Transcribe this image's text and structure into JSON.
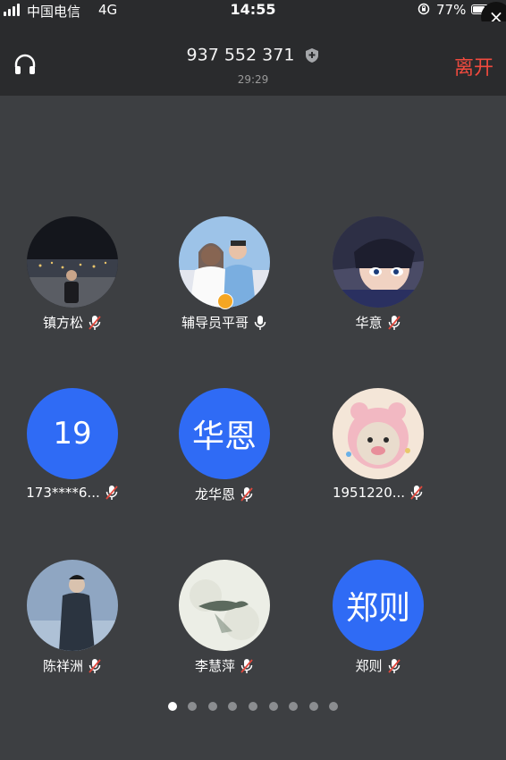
{
  "status_bar": {
    "carrier": "中国电信",
    "network": "4G",
    "time": "14:55",
    "battery_percent": "77%",
    "battery_level": 0.77,
    "close_label": "×"
  },
  "header": {
    "meeting_id": "937 552 371",
    "duration": "29:29",
    "leave_label": "离开"
  },
  "participants": [
    {
      "name": "镇方松",
      "mic": "muted",
      "avatar_type": "photo",
      "avatar_text": ""
    },
    {
      "name": "辅导员平哥",
      "mic": "on",
      "avatar_type": "photo",
      "avatar_text": "",
      "host": true
    },
    {
      "name": "华意",
      "mic": "muted",
      "avatar_type": "photo",
      "avatar_text": ""
    },
    {
      "name": "173****6...",
      "mic": "muted",
      "avatar_type": "text",
      "avatar_text": "19"
    },
    {
      "name": "龙华恩",
      "mic": "muted",
      "avatar_type": "text",
      "avatar_text": "华恩"
    },
    {
      "name": "1951220...",
      "mic": "muted",
      "avatar_type": "photo",
      "avatar_text": ""
    },
    {
      "name": "陈祥洲",
      "mic": "muted",
      "avatar_type": "photo",
      "avatar_text": ""
    },
    {
      "name": "李慧萍",
      "mic": "muted",
      "avatar_type": "photo",
      "avatar_text": ""
    },
    {
      "name": "郑则",
      "mic": "muted",
      "avatar_type": "text",
      "avatar_text": "郑则"
    }
  ],
  "pagination": {
    "pages": 9,
    "current": 1
  },
  "colors": {
    "accent": "#2f6bf5",
    "leave": "#f04a3e",
    "mic_muted": "#e0483d"
  }
}
